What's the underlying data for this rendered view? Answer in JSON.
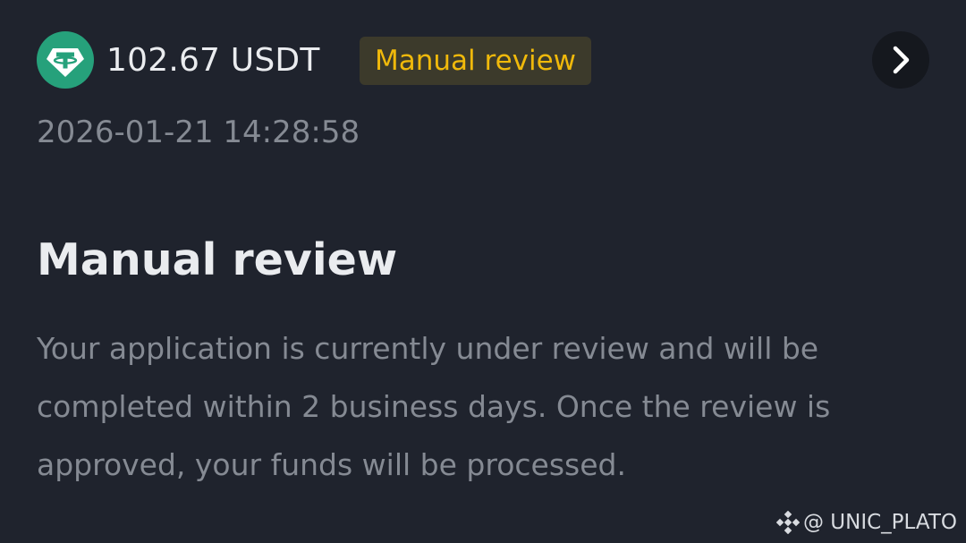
{
  "transaction": {
    "coin_icon": "tether-icon",
    "amount": "102.67 USDT",
    "status_badge": "Manual review",
    "details_icon": "chevron-right-icon",
    "timestamp": "2026-01-21 14:28:58"
  },
  "review": {
    "title": "Manual review",
    "message": "Your application is currently under review and will be completed within 2 business days. Once the review is approved, your funds will be processed."
  },
  "watermark": {
    "icon": "binance-logo-icon",
    "text": "@ UNIC_PLATO"
  },
  "colors": {
    "background": "#1f232d",
    "badge_text": "#f0b90b",
    "badge_bg": "#3c3a2b",
    "tether": "#26a17b",
    "primary_text": "#eaecef",
    "secondary_text": "#858a93"
  }
}
